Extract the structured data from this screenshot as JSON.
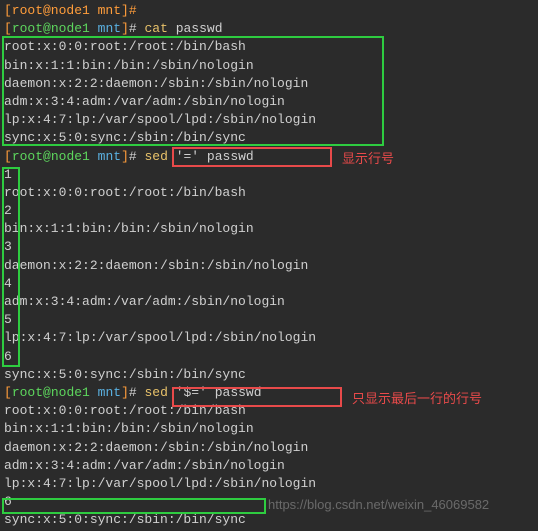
{
  "prompt": {
    "open": "[",
    "user": "root",
    "at": "@",
    "host": "node1",
    "path": " mnt",
    "close": "]",
    "hash": "# "
  },
  "prompt_top_partial": "[root@node1 mnt]# ",
  "commands": {
    "cat": {
      "name": "cat",
      "args": " passwd"
    },
    "sed1": {
      "name": "sed",
      "args": " '=' passwd"
    },
    "sed2": {
      "name": "sed",
      "args": " '$=' passwd"
    }
  },
  "cat_output": [
    "root:x:0:0:root:/root:/bin/bash",
    "bin:x:1:1:bin:/bin:/sbin/nologin",
    "daemon:x:2:2:daemon:/sbin:/sbin/nologin",
    "adm:x:3:4:adm:/var/adm:/sbin/nologin",
    "lp:x:4:7:lp:/var/spool/lpd:/sbin/nologin",
    "sync:x:5:0:sync:/sbin:/bin/sync"
  ],
  "sed1_output": [
    "1",
    "root:x:0:0:root:/root:/bin/bash",
    "2",
    "bin:x:1:1:bin:/bin:/sbin/nologin",
    "3",
    "daemon:x:2:2:daemon:/sbin:/sbin/nologin",
    "4",
    "adm:x:3:4:adm:/var/adm:/sbin/nologin",
    "5",
    "lp:x:4:7:lp:/var/spool/lpd:/sbin/nologin",
    "6",
    "sync:x:5:0:sync:/sbin:/bin/sync"
  ],
  "sed2_output": [
    "root:x:0:0:root:/root:/bin/bash",
    "bin:x:1:1:bin:/bin:/sbin/nologin",
    "daemon:x:2:2:daemon:/sbin:/sbin/nologin",
    "adm:x:3:4:adm:/var/adm:/sbin/nologin",
    "lp:x:4:7:lp:/var/spool/lpd:/sbin/nologin",
    "6",
    "sync:x:5:0:sync:/sbin:/bin/sync"
  ],
  "annotations": {
    "show_line_num": "显示行号",
    "show_last_line_num": "只显示最后一行的行号",
    "watermark": "https://blog.csdn.net/weixin_46069582"
  }
}
